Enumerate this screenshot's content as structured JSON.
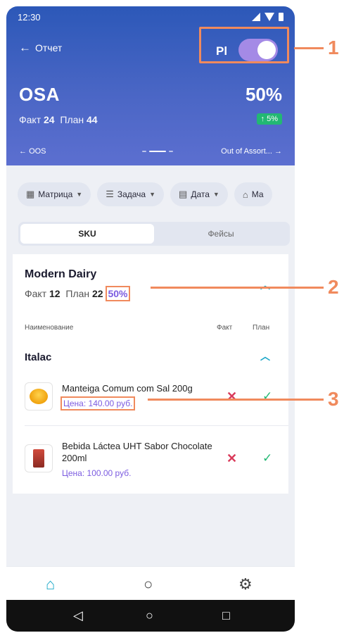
{
  "status": {
    "time": "12:30"
  },
  "header": {
    "back_label": "Отчет",
    "toggle_label": "Pl",
    "metric_name": "OSA",
    "metric_value": "50%",
    "fact_label": "Факт",
    "fact_value": "24",
    "plan_label": "План",
    "plan_value": "44",
    "delta": "↑ 5%",
    "prev_label": "OOS",
    "next_label": "Out of Assort..."
  },
  "filters": [
    {
      "icon": "grid-icon",
      "label": "Матрица"
    },
    {
      "icon": "task-icon",
      "label": "Задача"
    },
    {
      "icon": "calendar-icon",
      "label": "Дата"
    },
    {
      "icon": "store-icon",
      "label": "Ма"
    }
  ],
  "tabs": {
    "sku": "SKU",
    "faces": "Фейсы"
  },
  "group": {
    "title": "Modern Dairy",
    "fact_label": "Факт",
    "fact_value": "12",
    "plan_label": "План",
    "plan_value": "22",
    "percent": "50%"
  },
  "columns": {
    "name": "Наименование",
    "fact": "Факт",
    "plan": "План"
  },
  "subgroup": {
    "title": "Italac"
  },
  "products": [
    {
      "name": "Manteiga Comum com Sal 200g",
      "price": "Цена: 140.00 руб.",
      "fact": "missing",
      "plan": "ok"
    },
    {
      "name": "Bebida Láctea UHT Sabor Chocolate 200ml",
      "price": "Цена: 100.00 руб.",
      "fact": "missing",
      "plan": "ok"
    }
  ],
  "callouts": [
    "1",
    "2",
    "3"
  ],
  "colors": {
    "accent": "#f08a5d",
    "primary": "#3d5fc0",
    "purple": "#7c5ce0",
    "success": "#22b873",
    "error": "#d93a5a"
  }
}
